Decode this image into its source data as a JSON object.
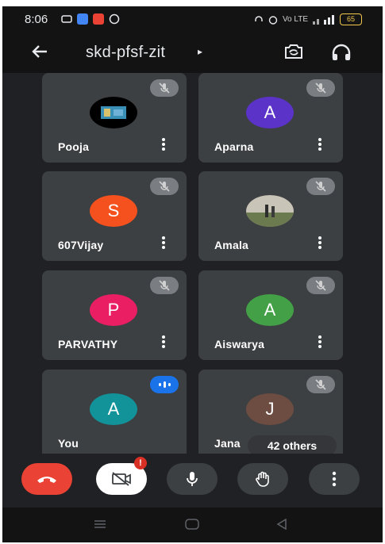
{
  "status_bar": {
    "time": "8:06",
    "battery": "65",
    "signal_text": "Vo LTE"
  },
  "header": {
    "meeting_code": "skd-pfsf-zit",
    "caret": "▸",
    "back_icon": "arrow-left-icon",
    "switch_camera_icon": "switch-camera-icon",
    "audio_icon": "headphones-icon"
  },
  "participants": [
    {
      "name": "Pooja",
      "avatar_type": "photo",
      "mic": "muted"
    },
    {
      "name": "Aparna",
      "avatar_letter": "A",
      "avatar_color": "#5b33c8",
      "mic": "muted"
    },
    {
      "name": "607Vijay",
      "avatar_letter": "S",
      "avatar_color": "#f4511e",
      "mic": "muted"
    },
    {
      "name": "Amala",
      "avatar_type": "photo",
      "mic": "muted"
    },
    {
      "name": "PARVATHY",
      "avatar_letter": "P",
      "avatar_color": "#e91e63",
      "mic": "muted"
    },
    {
      "name": "Aiswarya",
      "avatar_letter": "A",
      "avatar_color": "#43a047",
      "mic": "muted"
    },
    {
      "name": "You",
      "avatar_letter": "A",
      "avatar_color": "#12939a",
      "mic": "speaking"
    },
    {
      "name": "Jana",
      "avatar_letter": "J",
      "avatar_color": "#6d4c41",
      "mic": "muted"
    }
  ],
  "others_label": "42 others",
  "controls": {
    "end_call_icon": "end-call-icon",
    "camera_icon": "camera-off-icon",
    "camera_badge": "!",
    "mic_icon": "microphone-icon",
    "raise_hand_icon": "raise-hand-icon",
    "more_icon": "more-vert-icon"
  },
  "colors": {
    "end_call": "#ea4335",
    "speaking": "#1a73e8",
    "tile": "#3c4043",
    "background": "#202124"
  }
}
